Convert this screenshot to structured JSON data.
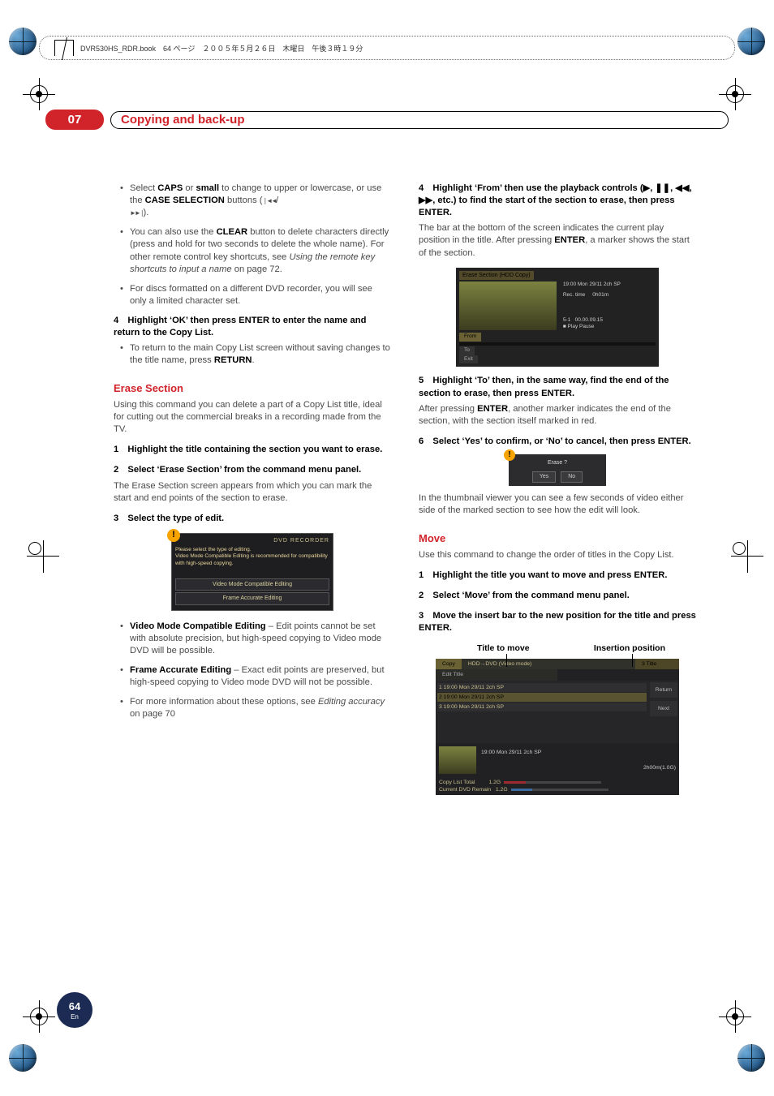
{
  "header": {
    "runhead": "DVR530HS_RDR.book　64 ページ　２００５年５月２６日　木曜日　午後３時１９分",
    "chapter": "07",
    "title": "Copying and back-up"
  },
  "left": {
    "bullets1": [
      {
        "pre": "Select ",
        "b1": "CAPS",
        "mid1": " or ",
        "b2": "small",
        "mid2": " to change to upper or lowercase, or use the ",
        "b3": "CASE SELECTION",
        "post": " buttons ("
      },
      {
        "pre": "You can also use the ",
        "b1": "CLEAR",
        "mid1": " button to delete characters directly (press and hold for two seconds to delete the whole name). For other remote control key shortcuts, see ",
        "i1": "Using the remote key shortcuts to input a name",
        "post": " on page 72."
      },
      {
        "pre": "For discs formatted on a different DVD recorder, you will see only a limited character set.",
        "b1": "",
        "mid1": "",
        "post": ""
      }
    ],
    "step4a": "4 Highlight ‘OK’ then press ENTER to enter the name and return to the Copy List.",
    "bullet_return": {
      "pre": "To return to the main Copy List screen without saving changes to the title name, press ",
      "b1": "RETURN",
      "post": "."
    },
    "section_erase": "Erase Section",
    "erase_intro": "Using this command you can delete a part of a Copy List title, ideal for cutting out the commercial breaks in a recording made from the TV.",
    "step1": "1 Highlight the title containing the section you want to erase.",
    "step2": "2 Select ‘Erase Section’ from the command menu panel.",
    "step2_body": "The Erase Section screen appears from which you can mark the start and end points of the section to erase.",
    "step3": "3 Select the type of edit.",
    "ui1": {
      "brand": "DVD RECORDER",
      "msg": "Please select the type of editing.\nVideo Mode Compatible Editing is recommended for compatibility with high-speed copying.",
      "btn1": "Video Mode Compatible Editing",
      "btn2": "Frame Accurate Editing"
    },
    "bullets2": [
      {
        "b": "Video Mode Compatible Editing",
        "rest": " – Edit points cannot be set with absolute precision, but high-speed copying to Video mode DVD will be possible."
      },
      {
        "b": "Frame Accurate Editing",
        "rest": " – Exact edit points are preserved, but high-speed copying to Video mode DVD will not be possible."
      }
    ],
    "bullet_editacc": {
      "pre": "For more information about these options, see ",
      "i": "Editing accuracy",
      "post": " on page 70"
    }
  },
  "right": {
    "step4": "4 Highlight ‘From’ then use the playback controls (▶, ❚❚, ◀◀, ▶▶, etc.) to find the start of the section to erase, then press ENTER.",
    "step4_body_a": "The bar at the bottom of the screen indicates the current play position in the title. After pressing ",
    "step4_body_b": "ENTER",
    "step4_body_c": ", a marker shows the start of the section.",
    "ui_erase": {
      "hdr": "Erase Section   (HDD Copy)",
      "dt": "19:00  Mon  29/11  2ch  SP",
      "rec": "Rec. time",
      "rec_v": "0h01m",
      "seg": "5-1",
      "tc": "00.00.09.15",
      "pp": "■ Play Pause",
      "t1": "From",
      "t2": "To",
      "t3": "Exit"
    },
    "step5": "5 Highlight ‘To’ then, in the same way, find the end of the section to erase, then press ENTER.",
    "step5_body_a": "After pressing ",
    "step5_body_b": "ENTER",
    "step5_body_c": ", another marker indicates the end of the section, with the section itself marked in red.",
    "step6": "6 Select ‘Yes’ to confirm, or ‘No’ to cancel, then press ENTER.",
    "ui_confirm": {
      "q": "Erase ?",
      "yes": "Yes",
      "no": "No"
    },
    "thumb_text": "In the thumbnail viewer you can see a few seconds of video either side of the marked section to see how the edit will look.",
    "section_move": "Move",
    "move_intro": "Use this command to change the order of titles in the Copy List.",
    "mstep1": "1 Highlight the title you want to move and press ENTER.",
    "mstep2": "2 Select ‘Move’ from the command menu panel.",
    "mstep3": "3 Move the insert bar to the new position for the title and press ENTER.",
    "labels": {
      "l": "Title to move",
      "r": "Insertion position"
    },
    "copylist": {
      "tab": "Copy",
      "mode": "HDD→DVD (Video mode)",
      "title_col": "3  Title",
      "edit": "Edit Title",
      "rows": [
        "1  19:00  Mon  29/11  2ch    SP",
        "2  19:00  Mon  29/11  2ch    SP",
        "3  19:00  Mon  29/11  2ch    SP"
      ],
      "side1": "Return",
      "side2": "Next",
      "thumb_dt": "19:00  Mon  29/11    2ch    SP",
      "dur": "2h00m(1.0G)",
      "f1": "Copy List Total",
      "f1v": "1.2G",
      "f2": "Current DVD Remain",
      "f2v": "1.2G"
    }
  },
  "page": {
    "num": "64",
    "lang": "En"
  }
}
